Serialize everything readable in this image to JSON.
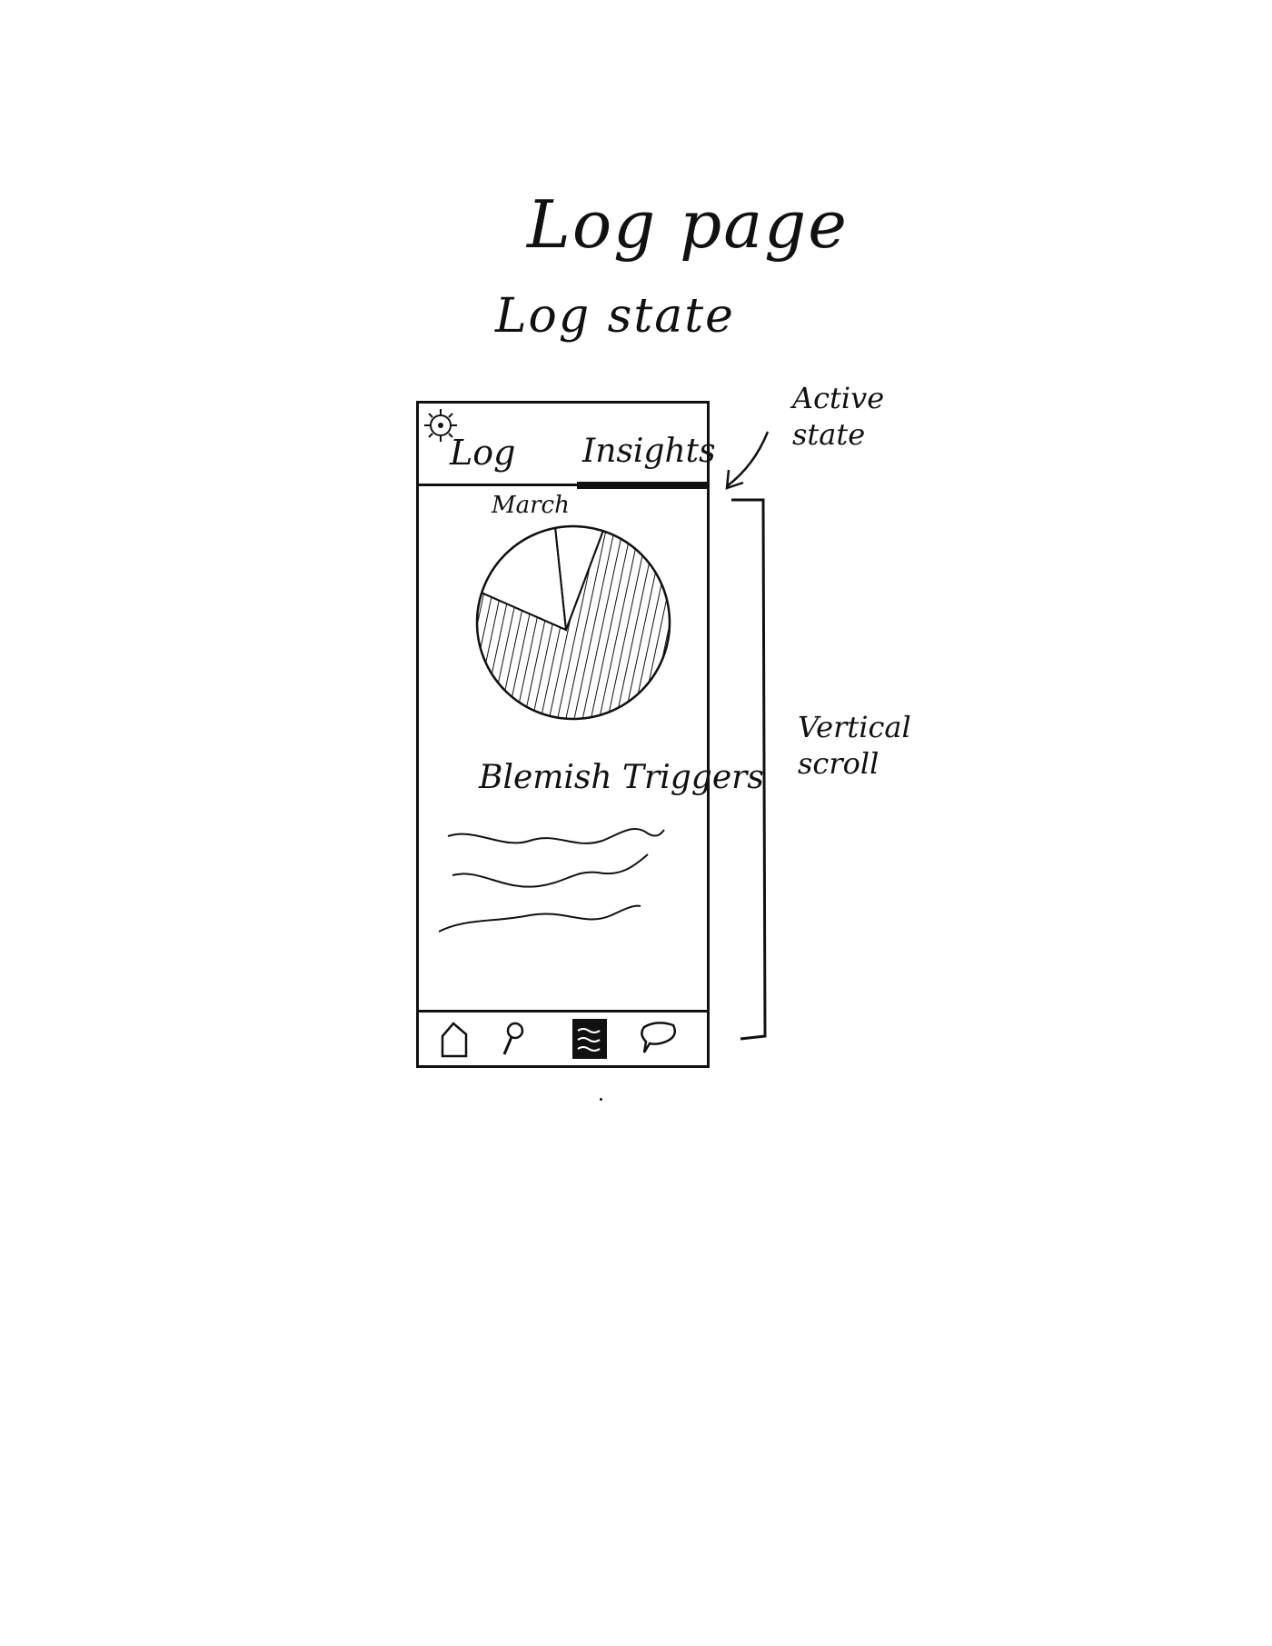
{
  "sketch": {
    "title": "Log page",
    "subtitle": "Log state"
  },
  "annotations": {
    "active_state": "Active state",
    "vertical_scroll": "Vertical scroll"
  },
  "phone": {
    "top_bar": {
      "settings_icon": "gear-icon",
      "tabs": [
        {
          "label": "Log",
          "active": false
        },
        {
          "label": "Insights",
          "active": true
        }
      ]
    },
    "content": {
      "month": "March",
      "triggers_heading": "Blemish Triggers",
      "trigger_items": [
        "",
        "",
        ""
      ]
    },
    "bottom_nav": {
      "items": [
        {
          "icon": "home-icon",
          "active": false
        },
        {
          "icon": "search-icon",
          "active": false
        },
        {
          "icon": "log-icon",
          "active": true
        },
        {
          "icon": "chat-icon",
          "active": false
        }
      ]
    }
  },
  "chart_data": {
    "type": "pie",
    "title": "March",
    "slices": [
      {
        "fill": "hatched",
        "value": 0.75
      },
      {
        "fill": "empty",
        "value": 0.17
      },
      {
        "fill": "empty",
        "value": 0.08
      }
    ]
  }
}
